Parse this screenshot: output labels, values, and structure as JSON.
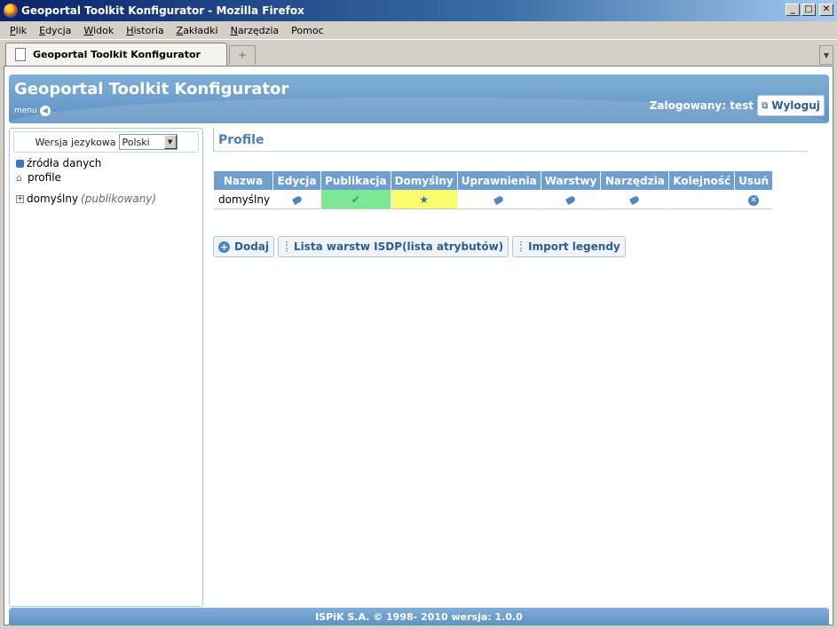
{
  "window": {
    "title": "Geoportal Toolkit Konfigurator - Mozilla Firefox"
  },
  "menubar": {
    "items": [
      {
        "accel": "P",
        "rest": "lik"
      },
      {
        "accel": "E",
        "rest": "dycja"
      },
      {
        "accel": "W",
        "rest": "idok"
      },
      {
        "accel": "H",
        "rest": "istoria"
      },
      {
        "accel": "Z",
        "rest": "akładki"
      },
      {
        "accel": "N",
        "rest": "arzędzia"
      },
      {
        "accel": "",
        "rest": "Pomoc"
      }
    ]
  },
  "tabs": {
    "active_label": "Geoportal Toolkit Konfigurator",
    "new_tab_glyph": "+"
  },
  "header": {
    "title": "Geoportal Toolkit Konfigurator",
    "menu_label": "menu",
    "logged_in": "Zalogowany: test",
    "logout_label": "Wyloguj"
  },
  "sidebar": {
    "lang_label": "Wersja jezykowa",
    "lang_value": "Polski",
    "items": [
      {
        "label": "źródła danych",
        "icon": "database-icon"
      },
      {
        "label": "profile",
        "icon": "home-icon"
      }
    ],
    "tree_node": {
      "label": "domyślny",
      "status": "(publikowany)"
    }
  },
  "main": {
    "title": "Profile",
    "table": {
      "headers": [
        "Nazwa",
        "Edycja",
        "Publikacja",
        "Domyślny",
        "Uprawnienia",
        "Warstwy",
        "Narzędzia",
        "Kolejność",
        "Usuń"
      ],
      "rows": [
        {
          "name": "domyślny"
        }
      ]
    },
    "actions": {
      "add_label": "Dodaj",
      "layers_label": "Lista warstw ISDP(lista atrybutów)",
      "legend_label": "Import legendy"
    }
  },
  "footer": {
    "text": "ISPiK S.A. © 1998- 2010 wersja: 1.0.0"
  },
  "colors": {
    "accent": "#6f9fcf",
    "publish_cell": "#7ce895",
    "default_cell": "#fbfb6e"
  }
}
